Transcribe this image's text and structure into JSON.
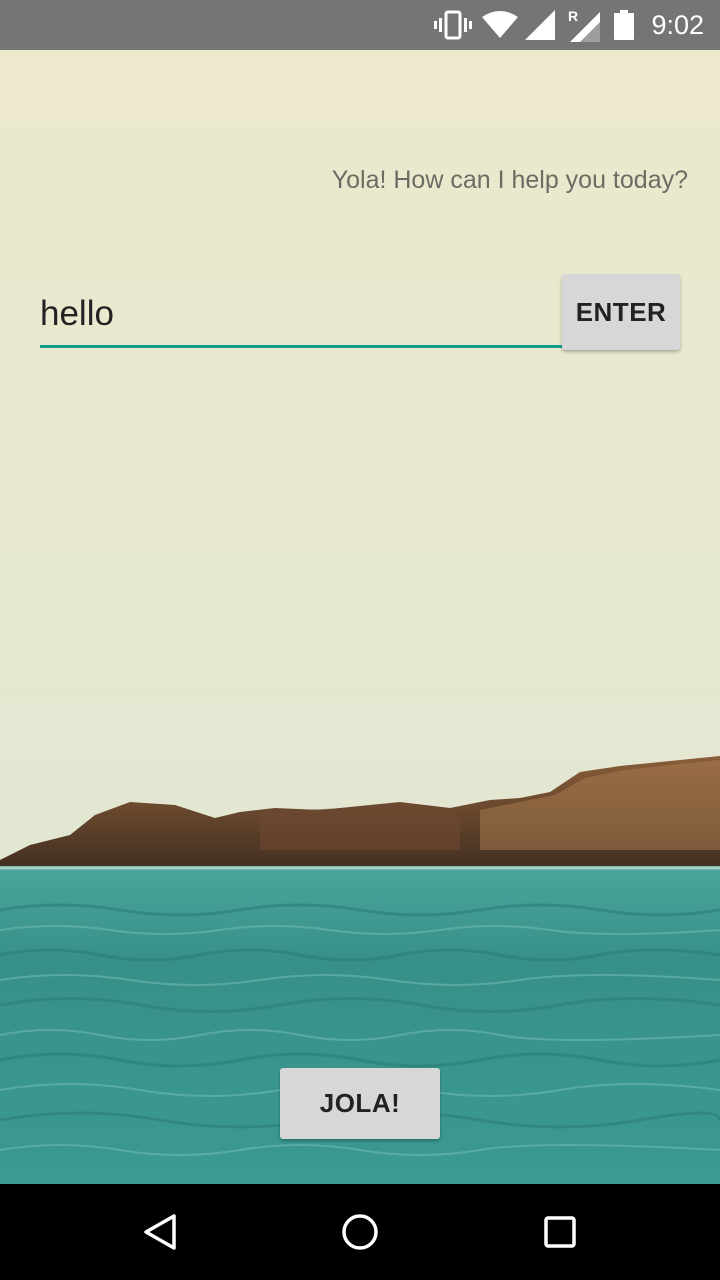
{
  "status_bar": {
    "time": "9:02",
    "icons": [
      "vibrate-icon",
      "wifi-icon",
      "cell-signal-icon",
      "roaming-signal-icon",
      "battery-icon"
    ],
    "roaming_label": "R"
  },
  "app": {
    "prompt": "Yola! How can I help you today?",
    "query_input": {
      "value": "hello",
      "accent_color": "#139e8f"
    },
    "enter_button_label": "ENTER",
    "jola_button_label": "JOLA!"
  },
  "nav_bar": {
    "buttons": [
      "back-icon",
      "home-icon",
      "recents-icon"
    ]
  },
  "colors": {
    "sky": "#ece9cc",
    "sea": "#3b9a92",
    "status_bar": "#757575",
    "button": "#d6d7d6"
  }
}
